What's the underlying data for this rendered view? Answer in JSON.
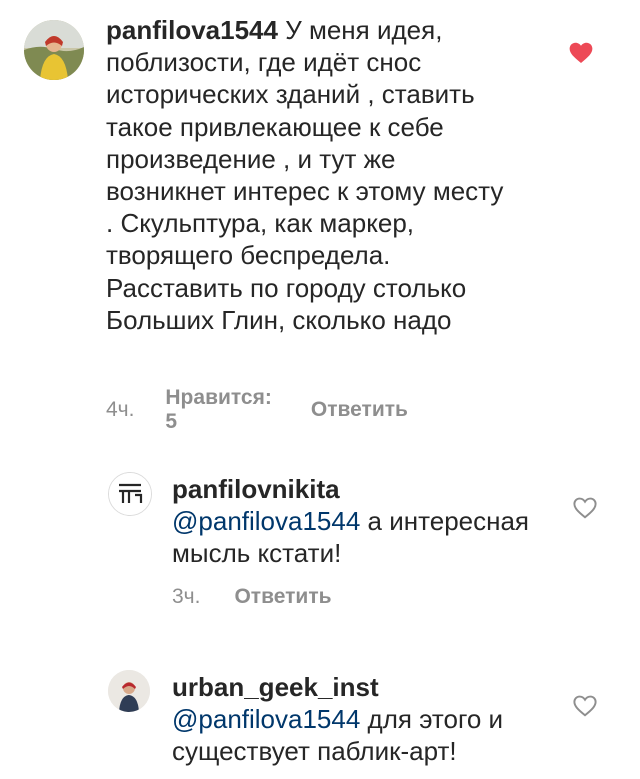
{
  "comments": [
    {
      "username": "panfilova1544",
      "text": "У меня идея, поблизости, где идёт снос исторических зданий , ставить такое привлекающее к себе произведение , и тут же возникнет интерес к этому месту . Скульптура, как маркер, творящего беспредела. Расставить по городу столько Больших Глин, сколько надо",
      "time": "4ч.",
      "likes_label": "Нравится: 5",
      "reply_label": "Ответить",
      "liked": true,
      "heart_color": "#ed4956",
      "avatar_icon": "avatar-photo"
    },
    {
      "username": "panfilovnikita",
      "mention": "@panfilova1544",
      "text": "а интересная мысль кстати!",
      "time": "3ч.",
      "reply_label": "Ответить",
      "liked": false,
      "avatar_icon": "logo-avatar"
    },
    {
      "username": "urban_geek_inst",
      "mention": "@panfilova1544",
      "text": "для этого и существует паблик-арт!",
      "liked": false,
      "avatar_icon": "avatar-photo"
    }
  ],
  "colors": {
    "text": "#262626",
    "meta": "#8e8e8e",
    "mention": "#00376b",
    "heart_liked": "#ed4956",
    "heart_outline": "#8e8e8e"
  }
}
